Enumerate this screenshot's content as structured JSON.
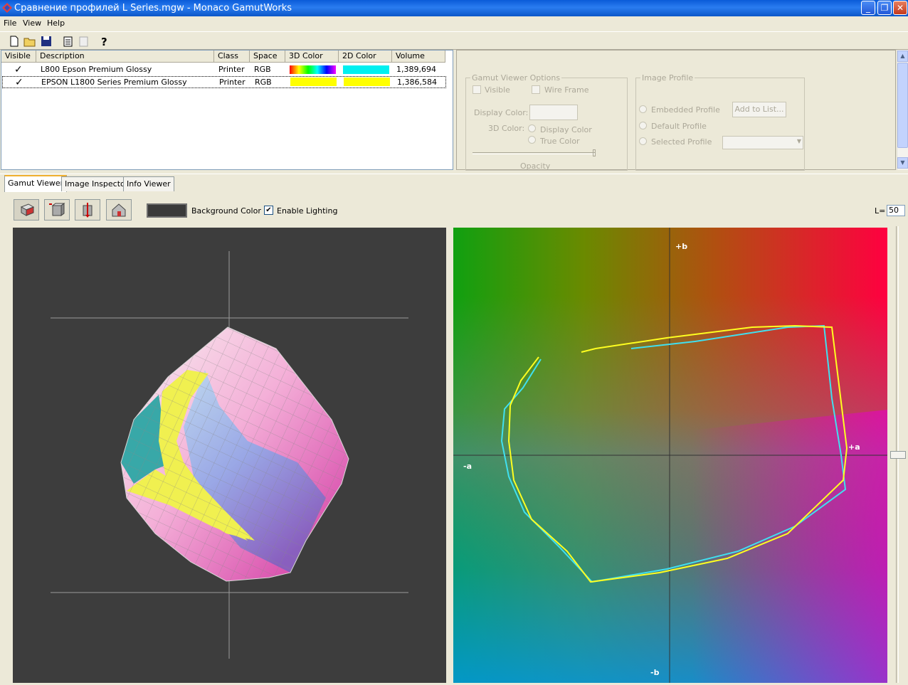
{
  "window": {
    "title": "Сравнение профилей L Series.mgw - Monaco GamutWorks",
    "minimize": "_",
    "restore": "❐",
    "close": "✕"
  },
  "menu": [
    "File",
    "View",
    "Help"
  ],
  "toolbar_icons": [
    "new-file-icon",
    "open-folder-icon",
    "save-icon",
    "add-profile-icon",
    "remove-profile-icon",
    "help-icon"
  ],
  "profile_table": {
    "columns": [
      "Visible",
      "Description",
      "Class",
      "Space",
      "3D Color",
      "2D Color",
      "Volume"
    ],
    "rows": [
      {
        "visible": "✓",
        "description": "L800 Epson Premium Glossy",
        "class": "Printer",
        "space": "RGB",
        "color3d": "rainbow",
        "color2d": "#00f0f0",
        "volume": "1,389,694"
      },
      {
        "visible": "✓",
        "description": "EPSON L1800 Series Premium Glossy",
        "class": "Printer",
        "space": "RGB",
        "color3d": "#ffff00",
        "color2d": "#ffff00",
        "volume": "1,386,584"
      }
    ]
  },
  "gamut_options": {
    "title": "Gamut Viewer Options",
    "visible_label": "Visible",
    "wireframe_label": "Wire Frame",
    "display_color_label": "Display Color:",
    "color3d_label": "3D Color:",
    "radio_display_color": "Display Color",
    "radio_true_color": "True Color",
    "opacity_label": "Opacity"
  },
  "image_profile": {
    "title": "Image Profile",
    "embedded": "Embedded Profile",
    "default": "Default Profile",
    "selected": "Selected Profile",
    "add_button": "Add to List..."
  },
  "tabs": [
    "Gamut Viewer",
    "Image Inspector",
    "Info Viewer"
  ],
  "active_tab": "Gamut Viewer",
  "viewer_toolbar": {
    "buttons": [
      "rotate-view-icon",
      "cube-view-icon",
      "flip-view-icon",
      "home-view-icon"
    ],
    "background_label": "Background Color",
    "background_color": "#3a3a3a",
    "lighting_label": "Enable Lighting",
    "lighting_checked": "✔",
    "l_label": "L=",
    "l_value": "50"
  },
  "plot2d": {
    "label_plus_b": "+b",
    "label_minus_b": "-b",
    "label_plus_a": "+a",
    "label_minus_a": "-a",
    "series": [
      {
        "color": "#40e0f0",
        "name": "L800 Epson Premium Glossy"
      },
      {
        "color": "#ffff20",
        "name": "EPSON L1800 Series Premium Glossy"
      }
    ]
  }
}
